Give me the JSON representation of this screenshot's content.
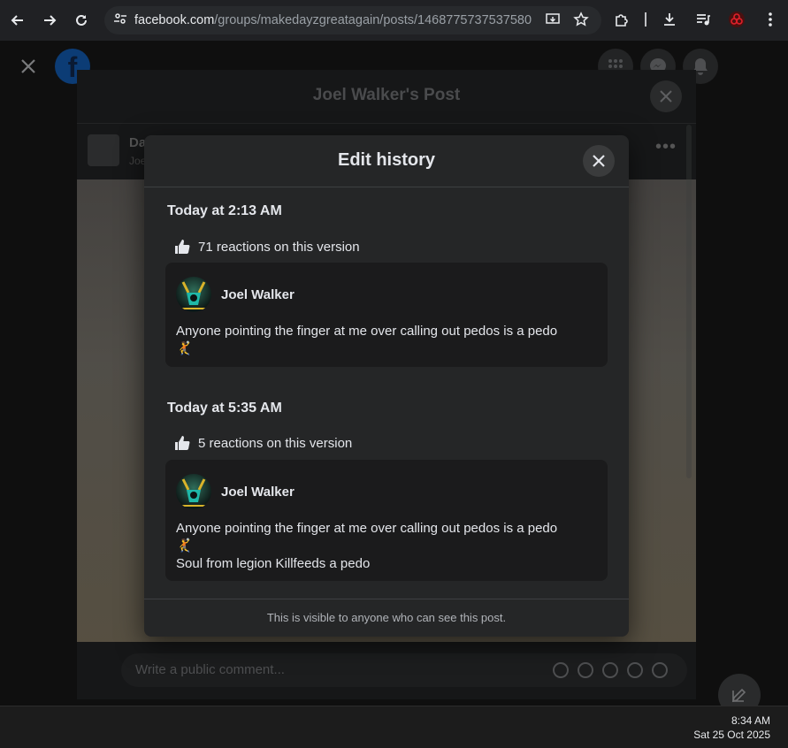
{
  "browser": {
    "url_host": "facebook.com",
    "url_path": "/groups/makedayzgreatagain/posts/1468775737537580"
  },
  "background_post": {
    "title": "Joel Walker's Post",
    "author_partial": "Da",
    "author_sub_partial": "Joe",
    "comment_placeholder": "Write a public comment..."
  },
  "modal": {
    "title": "Edit history",
    "footer": "This is visible to anyone who can see this post.",
    "versions": [
      {
        "time": "Today at 2:13 AM",
        "reactions": "71 reactions on this version",
        "author": "Joel Walker",
        "line1": "Anyone pointing the finger at me over calling out pedos is a pedo",
        "line2": "🤾",
        "line3": ""
      },
      {
        "time": "Today at 5:35 AM",
        "reactions": "5 reactions on this version",
        "author": "Joel Walker",
        "line1": "Anyone pointing the finger at me over calling out pedos is a pedo",
        "line2": "🤾",
        "line3": "Soul from legion Killfeeds a pedo"
      }
    ]
  },
  "taskbar": {
    "time": "8:34 AM",
    "date": "Sat 25 Oct 2025"
  }
}
